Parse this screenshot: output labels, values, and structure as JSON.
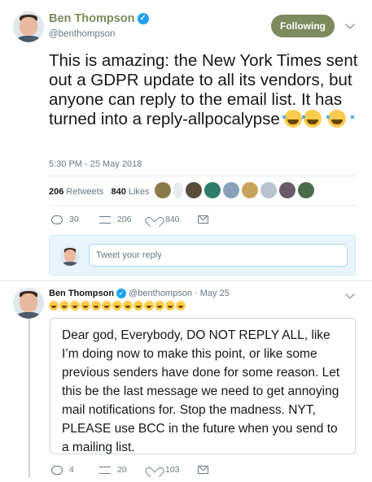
{
  "main_tweet": {
    "author_name": "Ben Thompson",
    "author_handle": "@benthompson",
    "follow_label": "Following",
    "text": "This is amazing: the New York Times sent out a GDPR update to all its vendors, but anyone can reply to the email list. It has turned into a reply-allpocalypse",
    "timestamp": "5:30 PM - 25 May 2018",
    "retweets_count": "206",
    "retweets_label": "Retweets",
    "likes_count": "840",
    "likes_label": "Likes",
    "actions": {
      "reply": "30",
      "retweet": "206",
      "like": "840"
    }
  },
  "reply_composer": {
    "placeholder": "Tweet your reply"
  },
  "reply_tweet": {
    "author_name": "Ben Thompson",
    "author_handle": "@benthompson",
    "date": "· May 25",
    "quote_text": "Dear god, Everybody, DO NOT REPLY ALL, like I’m doing now to make this point, or like some previous senders have done for some reason. Let this be the last message we need to get annoying mail notifications for. Stop the madness. NYT, PLEASE use BCC in the future when you send to a mailing list.",
    "actions": {
      "reply": "4",
      "retweet": "20",
      "like": "103"
    }
  },
  "icons": [
    "verified-icon",
    "chevron-down-icon",
    "reply-icon",
    "retweet-icon",
    "like-icon",
    "message-icon",
    "joy-emoji"
  ],
  "colors": {
    "accent": "#1da1f2",
    "follow_button": "#7c8a5d",
    "muted_text": "#657786",
    "reply_box_bg": "#e8f5fd"
  }
}
